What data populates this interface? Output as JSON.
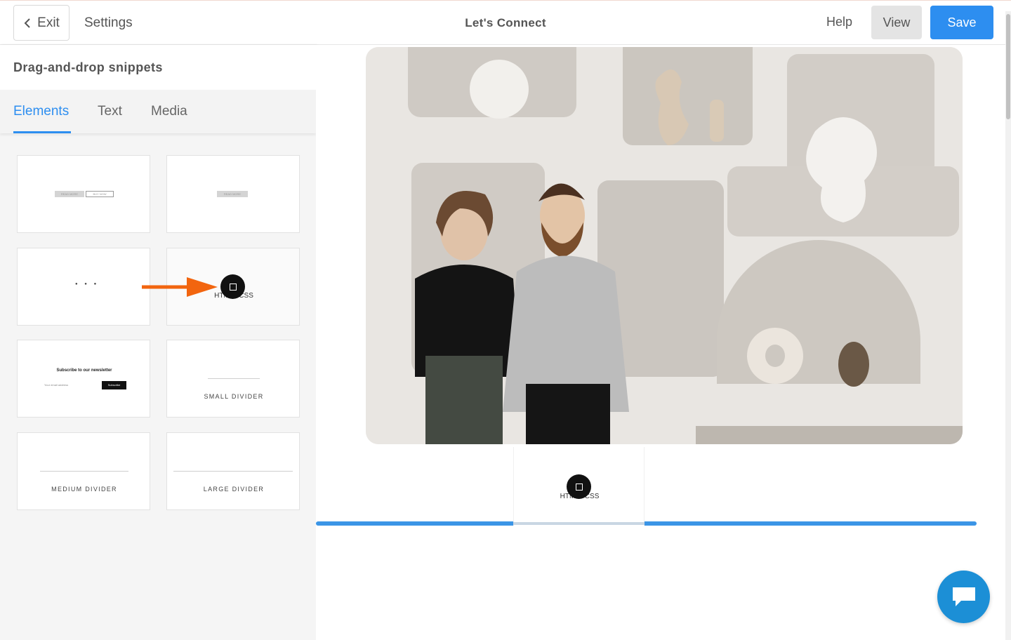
{
  "topbar": {
    "exit_label": "Exit",
    "settings_label": "Settings",
    "page_title": "Let's Connect",
    "help_label": "Help",
    "view_label": "View",
    "save_label": "Save",
    "accent_color": "#2d8ef0"
  },
  "sidebar": {
    "title": "Drag-and-drop snippets",
    "tabs": [
      {
        "label": "Elements",
        "active": true
      },
      {
        "label": "Text",
        "active": false
      },
      {
        "label": "Media",
        "active": false
      }
    ],
    "tiles": {
      "buttons_pair": {
        "btn_a": "READ MORE",
        "btn_b": "BUY NOW"
      },
      "button_single": {
        "btn": "READ MORE"
      },
      "social": {
        "dots": "● ● ●"
      },
      "html_css": {
        "label": "HTML / CSS"
      },
      "newsletter": {
        "title": "Subscribe to our newsletter",
        "input_placeholder": "Your email address",
        "button": "Subscribe"
      },
      "small_divider": {
        "label": "SMALL DIVIDER"
      },
      "medium_divider": {
        "label": "MEDIUM DIVIDER"
      },
      "large_divider": {
        "label": "LARGE DIVIDER"
      }
    }
  },
  "canvas": {
    "drag_preview_label": "HTML / CSS",
    "drop_indicator_color": "#3b95e6"
  },
  "icons": [
    "chevron-left-icon",
    "drag-handle-icon",
    "arrow-right-icon",
    "chat-icon"
  ]
}
